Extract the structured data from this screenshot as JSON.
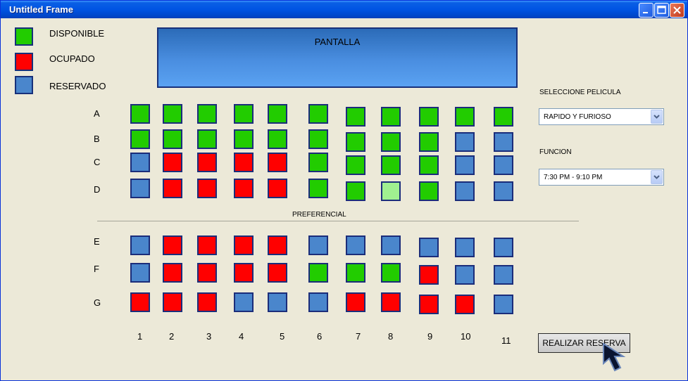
{
  "window": {
    "title": "Untitled Frame"
  },
  "legend": [
    {
      "label": "DISPONIBLE",
      "color": "#22cc00"
    },
    {
      "label": "OCUPADO",
      "color": "#ff0000"
    },
    {
      "label": "RESERVADO",
      "color": "#4a86cc"
    }
  ],
  "screen": {
    "label": "PANTALLA"
  },
  "colors": {
    "available": "#22cc00",
    "occupied": "#ff0000",
    "reserved": "#4a86cc",
    "selected": "#a0f090"
  },
  "rows": [
    {
      "label": "A",
      "seats": [
        "available",
        "available",
        "available",
        "available",
        "available",
        "available",
        "available",
        "available",
        "available",
        "available",
        "available"
      ]
    },
    {
      "label": "B",
      "seats": [
        "available",
        "available",
        "available",
        "available",
        "available",
        "available",
        "available",
        "available",
        "available",
        "reserved",
        "reserved"
      ]
    },
    {
      "label": "C",
      "seats": [
        "reserved",
        "occupied",
        "occupied",
        "occupied",
        "occupied",
        "available",
        "available",
        "available",
        "available",
        "reserved",
        "reserved"
      ]
    },
    {
      "label": "D",
      "seats": [
        "reserved",
        "occupied",
        "occupied",
        "occupied",
        "occupied",
        "available",
        "available",
        "selected",
        "available",
        "reserved",
        "reserved"
      ]
    },
    {
      "label": "E",
      "seats": [
        "reserved",
        "occupied",
        "occupied",
        "occupied",
        "occupied",
        "reserved",
        "reserved",
        "reserved",
        "reserved",
        "reserved",
        "reserved"
      ]
    },
    {
      "label": "F",
      "seats": [
        "reserved",
        "occupied",
        "occupied",
        "occupied",
        "occupied",
        "available",
        "available",
        "available",
        "occupied",
        "reserved",
        "reserved"
      ]
    },
    {
      "label": "G",
      "seats": [
        "occupied",
        "occupied",
        "occupied",
        "reserved",
        "reserved",
        "reserved",
        "occupied",
        "occupied",
        "occupied",
        "occupied",
        "reserved"
      ]
    }
  ],
  "columns": [
    "1",
    "2",
    "3",
    "4",
    "5",
    "6",
    "7",
    "8",
    "9",
    "10",
    "11"
  ],
  "preferencial_label": "PREFERENCIAL",
  "movie": {
    "label": "SELECCIONE PELICULA",
    "value": "RAPIDO Y FURIOSO"
  },
  "showtime": {
    "label": "FUNCION",
    "value": "7:30 PM - 9:10 PM"
  },
  "reserve_button": "REALIZAR RESERVA"
}
